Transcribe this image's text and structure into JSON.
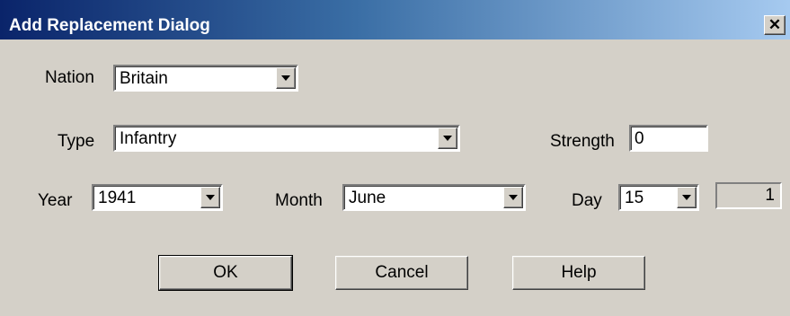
{
  "window": {
    "title": "Add Replacement Dialog",
    "close_glyph": "✕"
  },
  "fields": {
    "nation": {
      "label": "Nation",
      "value": "Britain"
    },
    "type": {
      "label": "Type",
      "value": "Infantry"
    },
    "strength": {
      "label": "Strength",
      "value": "0"
    },
    "year": {
      "label": "Year",
      "value": "1941"
    },
    "month": {
      "label": "Month",
      "value": "June"
    },
    "day": {
      "label": "Day",
      "value": "15"
    },
    "count_display": "1"
  },
  "buttons": {
    "ok": "OK",
    "cancel": "Cancel",
    "help": "Help"
  },
  "colors": {
    "titlebar_start": "#0a246a",
    "titlebar_end": "#a6caf0",
    "face": "#d4d0c8"
  }
}
